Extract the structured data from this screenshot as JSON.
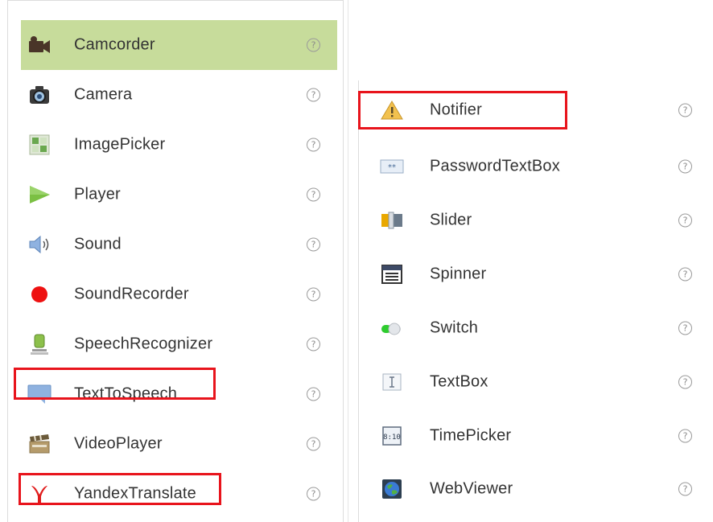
{
  "palette": {
    "selected_bg": "#c7dc9b",
    "highlight_border": "#e8141c",
    "label_color": "#333333"
  },
  "left_list": {
    "items": [
      {
        "label": "Camcorder",
        "icon": "camcorder-icon",
        "help": "?",
        "selected": true
      },
      {
        "label": "Camera",
        "icon": "camera-icon",
        "help": "?"
      },
      {
        "label": "ImagePicker",
        "icon": "image-picker-icon",
        "help": "?"
      },
      {
        "label": "Player",
        "icon": "play-icon",
        "help": "?"
      },
      {
        "label": "Sound",
        "icon": "speaker-icon",
        "help": "?"
      },
      {
        "label": "SoundRecorder",
        "icon": "record-dot-icon",
        "help": "?"
      },
      {
        "label": "SpeechRecognizer",
        "icon": "microphone-icon",
        "help": "?"
      },
      {
        "label": "TextToSpeech",
        "icon": "speech-bubble-icon",
        "help": "?",
        "highlighted": true
      },
      {
        "label": "VideoPlayer",
        "icon": "clapperboard-icon",
        "help": "?"
      },
      {
        "label": "YandexTranslate",
        "icon": "yandex-icon",
        "help": "?",
        "highlighted": true
      }
    ]
  },
  "right_list": {
    "items": [
      {
        "label": "Notifier",
        "icon": "warning-icon",
        "help": "?",
        "highlighted": true
      },
      {
        "label": "PasswordTextBox",
        "icon": "password-field-icon",
        "help": "?"
      },
      {
        "label": "Slider",
        "icon": "slider-icon",
        "help": "?"
      },
      {
        "label": "Spinner",
        "icon": "spinner-list-icon",
        "help": "?"
      },
      {
        "label": "Switch",
        "icon": "toggle-switch-icon",
        "help": "?"
      },
      {
        "label": "TextBox",
        "icon": "text-cursor-icon",
        "help": "?"
      },
      {
        "label": "TimePicker",
        "icon": "clock-display-icon",
        "help": "?",
        "icon_text": "8:10"
      },
      {
        "label": "WebViewer",
        "icon": "globe-icon",
        "help": "?"
      }
    ]
  }
}
